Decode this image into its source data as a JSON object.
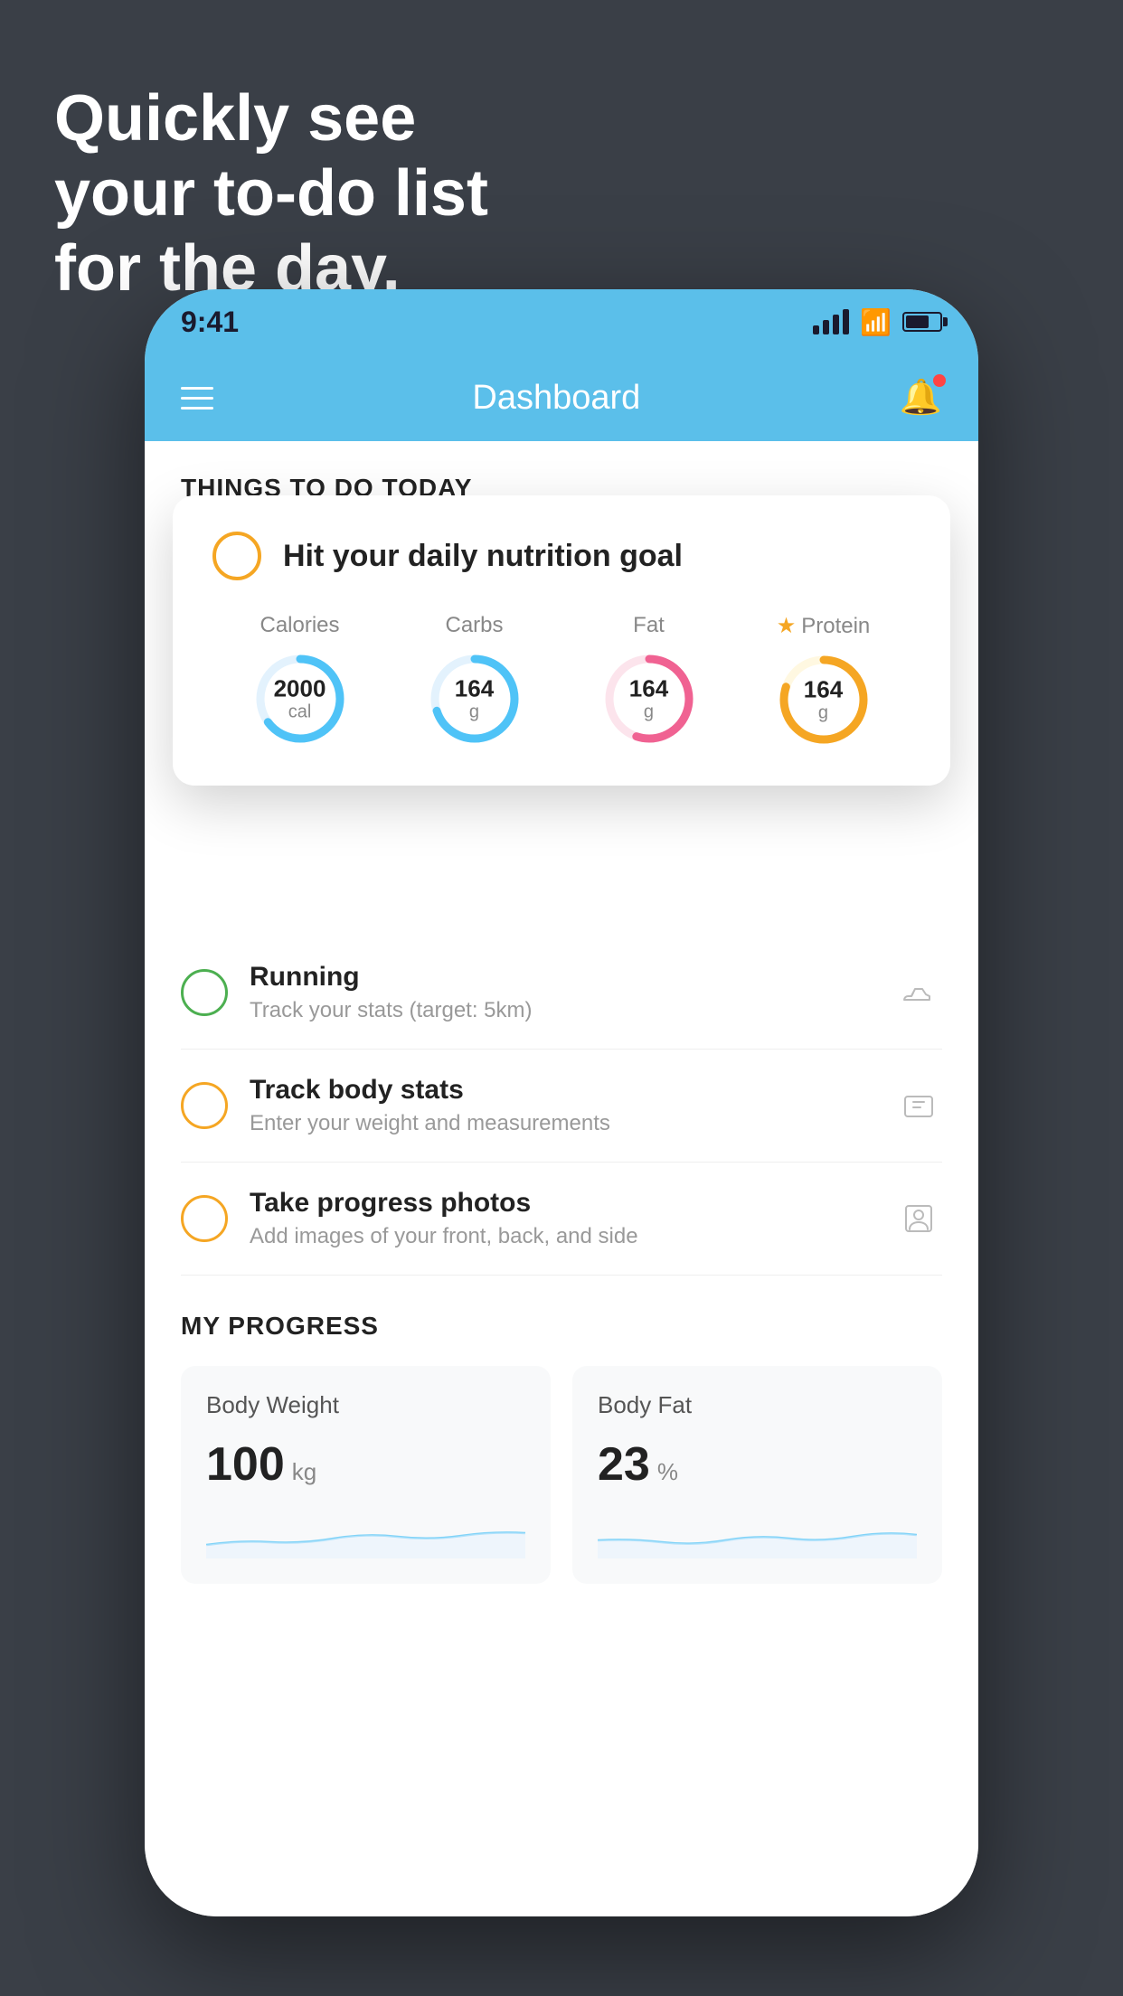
{
  "headline": {
    "line1": "Quickly see",
    "line2": "your to-do list",
    "line3": "for the day."
  },
  "statusBar": {
    "time": "9:41"
  },
  "header": {
    "title": "Dashboard"
  },
  "thingsToDo": {
    "sectionTitle": "THINGS TO DO TODAY"
  },
  "nutritionCard": {
    "title": "Hit your daily nutrition goal",
    "stats": [
      {
        "label": "Calories",
        "value": "2000",
        "unit": "cal",
        "color": "#4fc3f7",
        "trackBg": "#e3f2fd",
        "percent": 65,
        "starred": false
      },
      {
        "label": "Carbs",
        "value": "164",
        "unit": "g",
        "color": "#4fc3f7",
        "trackBg": "#e3f2fd",
        "percent": 70,
        "starred": false
      },
      {
        "label": "Fat",
        "value": "164",
        "unit": "g",
        "color": "#f06292",
        "trackBg": "#fce4ec",
        "percent": 55,
        "starred": false
      },
      {
        "label": "Protein",
        "value": "164",
        "unit": "g",
        "color": "#f5a623",
        "trackBg": "#fff8e1",
        "percent": 80,
        "starred": true
      }
    ]
  },
  "todoItems": [
    {
      "id": "running",
      "name": "Running",
      "desc": "Track your stats (target: 5km)",
      "circleColor": "green",
      "icon": "shoe"
    },
    {
      "id": "track-body",
      "name": "Track body stats",
      "desc": "Enter your weight and measurements",
      "circleColor": "yellow",
      "icon": "scale"
    },
    {
      "id": "progress-photos",
      "name": "Take progress photos",
      "desc": "Add images of your front, back, and side",
      "circleColor": "yellow",
      "icon": "portrait"
    }
  ],
  "myProgress": {
    "sectionTitle": "MY PROGRESS",
    "cards": [
      {
        "title": "Body Weight",
        "value": "100",
        "unit": "kg"
      },
      {
        "title": "Body Fat",
        "value": "23",
        "unit": "%"
      }
    ]
  }
}
